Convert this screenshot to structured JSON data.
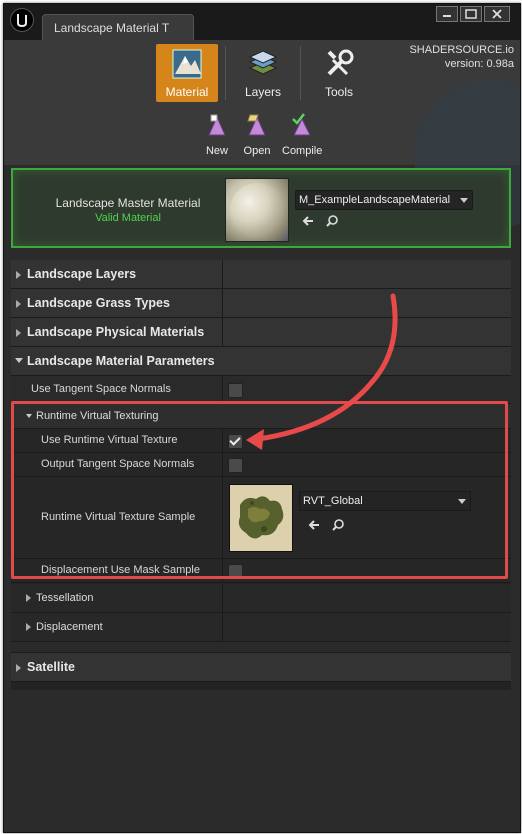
{
  "window": {
    "tab_title": "Landscape Material T",
    "watermark": {
      "site": "SHADERSOURCE.io",
      "version": "version: 0.98a"
    }
  },
  "toolbar": {
    "modes": [
      {
        "label": "Material",
        "icon": "material-mode-icon",
        "active": true
      },
      {
        "label": "Layers",
        "icon": "layers-mode-icon",
        "active": false
      },
      {
        "label": "Tools",
        "icon": "tools-mode-icon",
        "active": false
      }
    ],
    "actions": [
      {
        "label": "New",
        "icon": "new-material-icon"
      },
      {
        "label": "Open",
        "icon": "open-material-icon"
      },
      {
        "label": "Compile",
        "icon": "compile-icon"
      }
    ]
  },
  "master": {
    "title": "Landscape Master Material",
    "status": "Valid Material",
    "asset": "M_ExampleLandscapeMaterial"
  },
  "details": {
    "categories": [
      {
        "label": "Landscape Layers"
      },
      {
        "label": "Landscape Grass Types"
      },
      {
        "label": "Landscape Physical Materials"
      },
      {
        "label": "Landscape Material Parameters"
      }
    ],
    "use_tangent_space_normals": {
      "label": "Use Tangent Space Normals",
      "checked": false
    },
    "rvt": {
      "label": "Runtime Virtual Texturing",
      "use_rvt": {
        "label": "Use Runtime Virtual Texture",
        "checked": true
      },
      "output_tangent": {
        "label": "Output Tangent Space Normals",
        "checked": false
      },
      "rvt_sample": {
        "label": "Runtime Virtual Texture Sample",
        "asset": "RVT_Global"
      },
      "displacement_mask": {
        "label": "Displacement Use Mask Sample",
        "checked": false
      }
    },
    "tessellation": {
      "label": "Tessellation"
    },
    "displacement": {
      "label": "Displacement"
    },
    "satellite": {
      "label": "Satellite"
    }
  },
  "colors": {
    "accent": "#d6851b",
    "valid": "#4ed34e",
    "highlight": "#e04a4a"
  }
}
